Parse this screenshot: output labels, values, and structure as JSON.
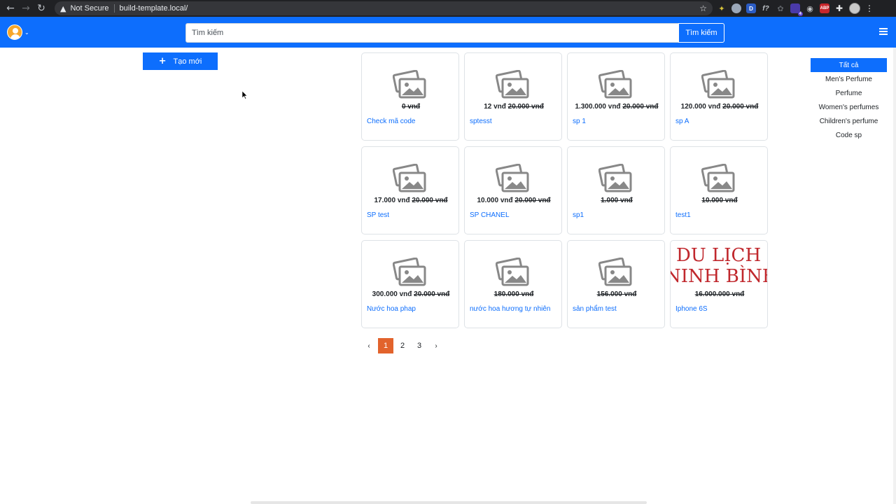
{
  "browser": {
    "security_label": "Not Secure",
    "url": "build-template.local/",
    "icons": [
      "back-icon",
      "forward-icon",
      "reload-icon",
      "warning-icon",
      "star-icon",
      "puzzle-icon",
      "menu-icon"
    ],
    "extension_badge": "4",
    "extension_abp": "ABP",
    "extension_d": "D",
    "extension_f": "f?"
  },
  "header": {
    "search": {
      "placeholder": "Tìm kiếm",
      "button_label": "Tìm kiếm"
    },
    "brand_color": "#0d6efd"
  },
  "create_button_label": "Tạo mới",
  "products": [
    {
      "price": "",
      "old_price": "0 vnđ",
      "name": "Check mã code",
      "image": "placeholder"
    },
    {
      "price": "12 vnđ",
      "old_price": "20.000 vnđ",
      "name": "sptesst",
      "image": "placeholder"
    },
    {
      "price": "1.300.000 vnđ",
      "old_price": "20.000 vnđ",
      "name": "sp 1",
      "image": "placeholder"
    },
    {
      "price": "120.000 vnđ",
      "old_price": "20.000 vnđ",
      "name": "sp A",
      "image": "placeholder"
    },
    {
      "price": "17.000 vnđ",
      "old_price": "20.000 vnđ",
      "name": "SP test",
      "image": "placeholder"
    },
    {
      "price": "10.000 vnđ",
      "old_price": "20.000 vnđ",
      "name": "SP CHANEL",
      "image": "placeholder"
    },
    {
      "price": "",
      "old_price": "1.000 vnđ",
      "name": "sp1",
      "image": "placeholder"
    },
    {
      "price": "",
      "old_price": "10.000 vnđ",
      "name": "test1",
      "image": "placeholder"
    },
    {
      "price": "300.000 vnđ",
      "old_price": "20.000 vnđ",
      "name": "Nước hoa phap",
      "image": "placeholder"
    },
    {
      "price": "",
      "old_price": "180.000 vnđ",
      "name": "nước hoa hương tự nhiên",
      "image": "placeholder"
    },
    {
      "price": "",
      "old_price": "156.000 vnđ",
      "name": "sản phẩm test",
      "image": "placeholder"
    },
    {
      "price": "",
      "old_price": "16.000.000 vnđ",
      "name": "Iphone 6S",
      "image": "photo",
      "photo_text": [
        "DU LỊCH",
        "NINH BÌNH"
      ]
    }
  ],
  "pagination": {
    "prev": "‹",
    "pages": [
      "1",
      "2",
      "3"
    ],
    "current": "1",
    "next": "›",
    "active_color": "#e2632c"
  },
  "categories": [
    {
      "label": "Tất cả",
      "active": true
    },
    {
      "label": "Men's Perfume",
      "active": false
    },
    {
      "label": "Perfume",
      "active": false
    },
    {
      "label": "Women's perfumes",
      "active": false
    },
    {
      "label": "Children's perfume",
      "active": false
    },
    {
      "label": "Code sp",
      "active": false
    }
  ]
}
